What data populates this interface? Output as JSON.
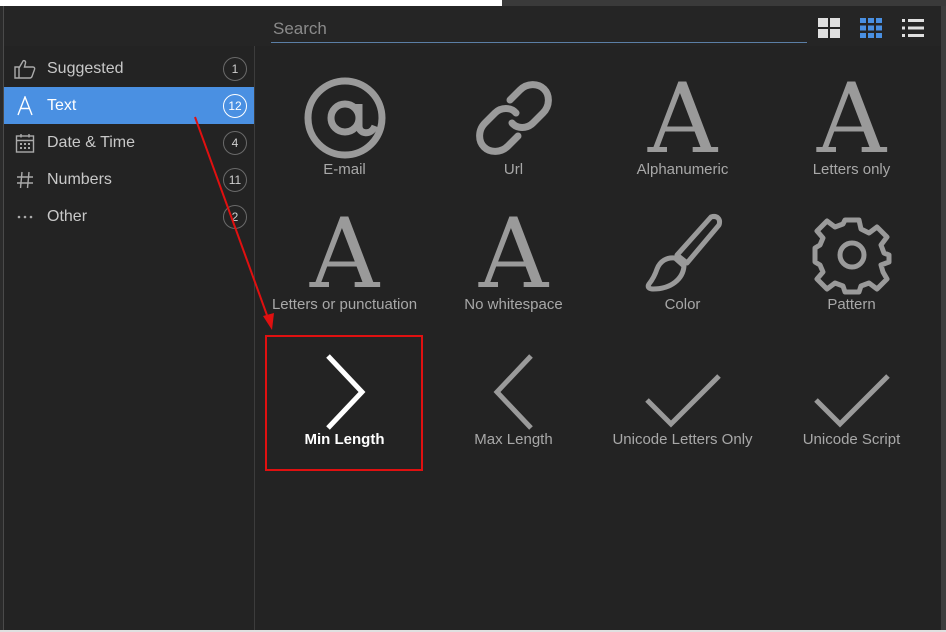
{
  "search": {
    "placeholder": "Search",
    "value": ""
  },
  "view_modes": [
    {
      "icon": "large-grid-icon",
      "active": false
    },
    {
      "icon": "small-grid-icon",
      "active": true
    },
    {
      "icon": "list-icon",
      "active": false
    }
  ],
  "sidebar": {
    "items": [
      {
        "label": "Suggested",
        "count": "1",
        "icon": "thumbs-up-icon",
        "active": false
      },
      {
        "label": "Text",
        "count": "12",
        "icon": "letter-a-icon",
        "active": true
      },
      {
        "label": "Date & Time",
        "count": "4",
        "icon": "calendar-icon",
        "active": false
      },
      {
        "label": "Numbers",
        "count": "11",
        "icon": "hash-icon",
        "active": false
      },
      {
        "label": "Other",
        "count": "2",
        "icon": "ellipsis-icon",
        "active": false
      }
    ]
  },
  "tiles": [
    {
      "label": "E-mail",
      "icon": "at-sign-icon"
    },
    {
      "label": "Url",
      "icon": "link-icon"
    },
    {
      "label": "Alphanumeric",
      "icon": "letter-a-icon"
    },
    {
      "label": "Letters only",
      "icon": "letter-a-icon"
    },
    {
      "label": "Letters or punctuation",
      "icon": "letter-a-icon"
    },
    {
      "label": "No whitespace",
      "icon": "letter-a-icon"
    },
    {
      "label": "Color",
      "icon": "paintbrush-icon"
    },
    {
      "label": "Pattern",
      "icon": "gear-icon"
    },
    {
      "label": "Min Length",
      "icon": "chevron-right-icon",
      "highlight": true
    },
    {
      "label": "Max Length",
      "icon": "chevron-left-icon"
    },
    {
      "label": "Unicode Letters Only",
      "icon": "checkmark-icon"
    },
    {
      "label": "Unicode Script",
      "icon": "checkmark-icon"
    }
  ],
  "colors": {
    "accent": "#4a90e2",
    "annotation": "#e01010",
    "icon": "#9a9a9a"
  }
}
